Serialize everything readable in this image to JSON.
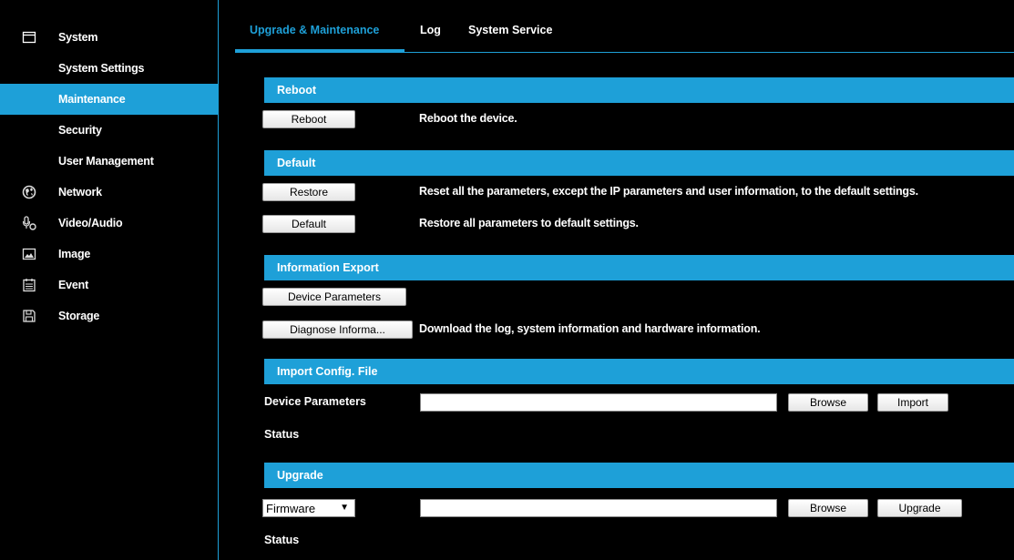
{
  "sidebar": {
    "items": [
      {
        "label": "System",
        "icon": "window-icon"
      },
      {
        "label": "System Settings"
      },
      {
        "label": "Maintenance",
        "active": true
      },
      {
        "label": "Security"
      },
      {
        "label": "User Management"
      },
      {
        "label": "Network",
        "icon": "globe-icon"
      },
      {
        "label": "Video/Audio",
        "icon": "microphone-icon"
      },
      {
        "label": "Image",
        "icon": "image-icon"
      },
      {
        "label": "Event",
        "icon": "calendar-icon"
      },
      {
        "label": "Storage",
        "icon": "floppy-disk-icon"
      }
    ]
  },
  "tabs": [
    {
      "label": "Upgrade & Maintenance",
      "active": true
    },
    {
      "label": "Log"
    },
    {
      "label": "System Service"
    }
  ],
  "sections": {
    "reboot": {
      "title": "Reboot",
      "button": "Reboot",
      "description": "Reboot the device."
    },
    "default": {
      "title": "Default",
      "restore_button": "Restore",
      "restore_description": "Reset all the parameters, except the IP parameters and user information, to the default settings.",
      "default_button": "Default",
      "default_description": "Restore all parameters to default settings."
    },
    "export": {
      "title": "Information Export",
      "device_params_button": "Device Parameters",
      "diagnose_button": "Diagnose Informa...",
      "diagnose_description": "Download the log, system information and hardware information."
    },
    "import": {
      "title": "Import Config. File",
      "label": "Device Parameters",
      "file_value": "",
      "browse_button": "Browse",
      "import_button": "Import",
      "status_label": "Status"
    },
    "upgrade": {
      "title": "Upgrade",
      "select_value": "Firmware",
      "file_value": "",
      "browse_button": "Browse",
      "upgrade_button": "Upgrade",
      "status_label": "Status"
    }
  },
  "colors": {
    "accent": "#1ea0d8",
    "background": "#000000"
  }
}
